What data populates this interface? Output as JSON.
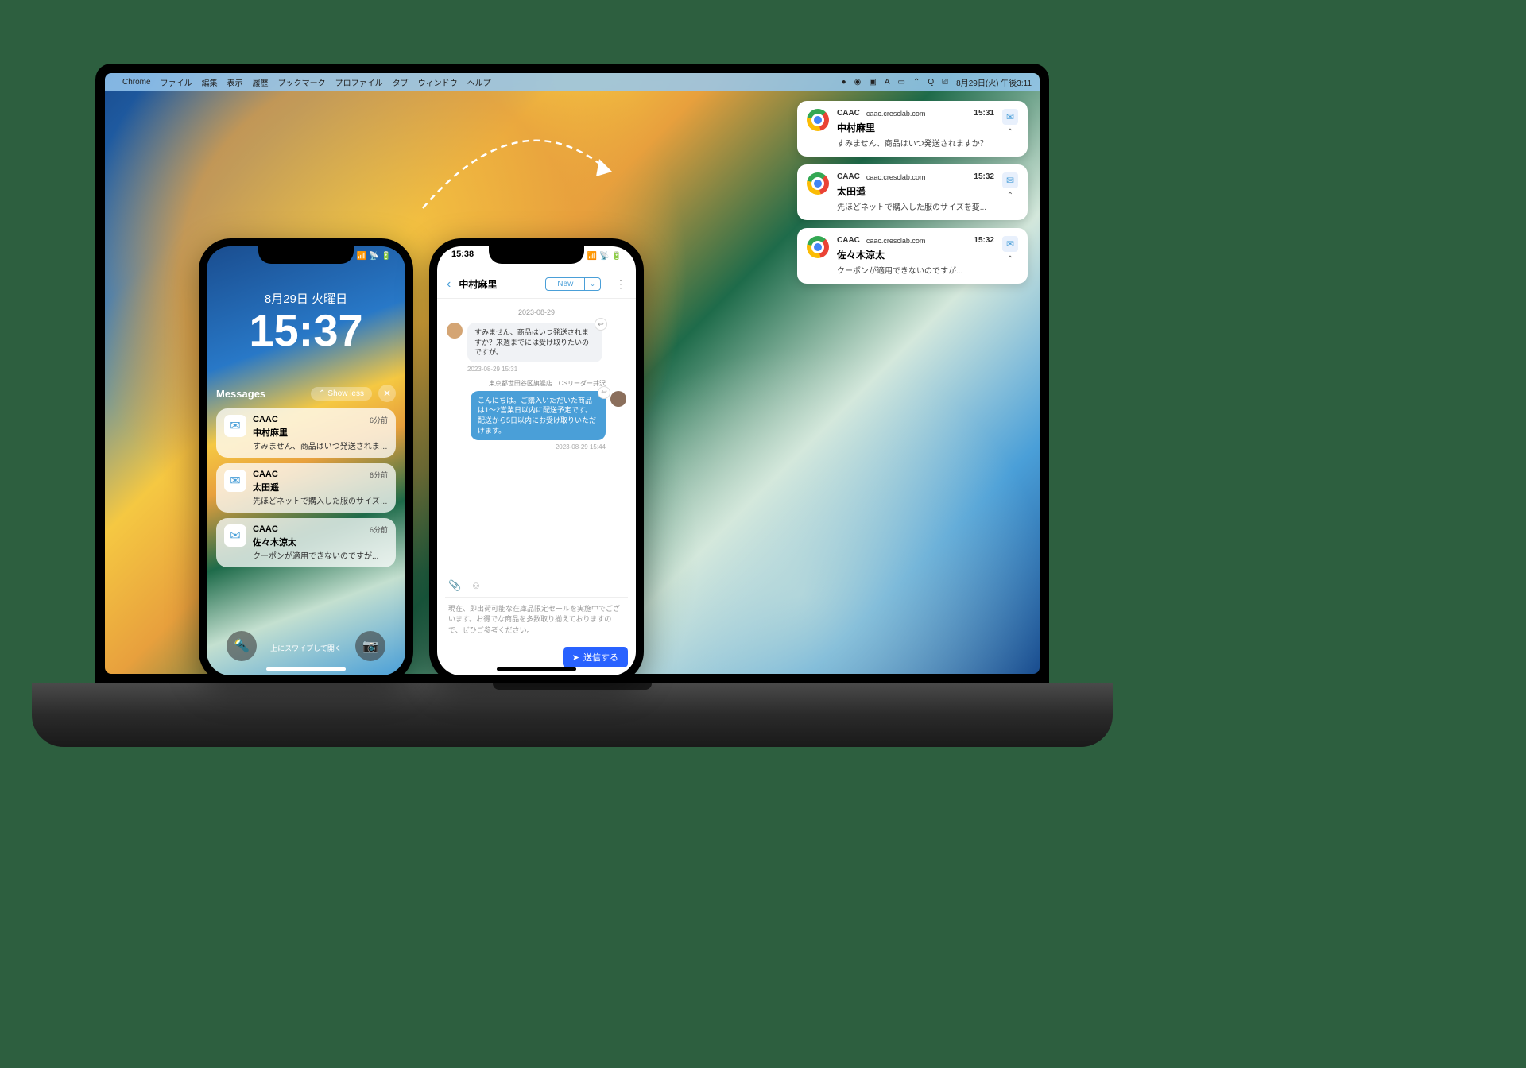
{
  "menubar": {
    "app": "Chrome",
    "items": [
      "ファイル",
      "編集",
      "表示",
      "履歴",
      "ブックマーク",
      "プロファイル",
      "タブ",
      "ウィンドウ",
      "ヘルプ"
    ],
    "datetime": "8月29日(火) 午後3:11"
  },
  "desktop_notifs": [
    {
      "app": "CAAC",
      "domain": "caac.cresclab.com",
      "time": "15:31",
      "name": "中村麻里",
      "msg": "すみません、商品はいつ発送されますか？"
    },
    {
      "app": "CAAC",
      "domain": "caac.cresclab.com",
      "time": "15:32",
      "name": "太田遥",
      "msg": "先ほどネットで購入した服のサイズを変..."
    },
    {
      "app": "CAAC",
      "domain": "caac.cresclab.com",
      "time": "15:32",
      "name": "佐々木涼太",
      "msg": "クーポンが適用できないのですが..."
    }
  ],
  "phone1": {
    "date": "8月29日 火曜日",
    "time": "15:37",
    "group_title": "Messages",
    "show_less": "Show less",
    "swipe_hint": "上にスワイプして開く",
    "notifs": [
      {
        "app": "CAAC",
        "time": "6分前",
        "name": "中村麻里",
        "msg": "すみません、商品はいつ発送されますか？"
      },
      {
        "app": "CAAC",
        "time": "6分前",
        "name": "太田遥",
        "msg": "先ほどネットで購入した服のサイズを変..."
      },
      {
        "app": "CAAC",
        "time": "6分前",
        "name": "佐々木涼太",
        "msg": "クーポンが適用できないのですが..."
      }
    ]
  },
  "phone2": {
    "status_time": "15:38",
    "contact": "中村麻里",
    "tag": "New",
    "date": "2023-08-29",
    "msg_in": "すみません、商品はいつ発送されますか？来週までには受け取りたいのですが。",
    "ts_in": "2023-08-29 15:31",
    "agent_label": "東京都世田谷区旗艦店　CSリーダー井沢",
    "msg_out": "こんにちは。ご購入いただいた商品は1〜2営業日以内に配送予定です。配送から5日以内にお受け取りいただけます。",
    "ts_out": "2023-08-29 15:44",
    "input_placeholder": "現在、即出荷可能な在庫品限定セールを実施中でございます。お得でな商品を多数取り揃えておりますので、ぜひご参考ください。",
    "send": "送信する"
  }
}
